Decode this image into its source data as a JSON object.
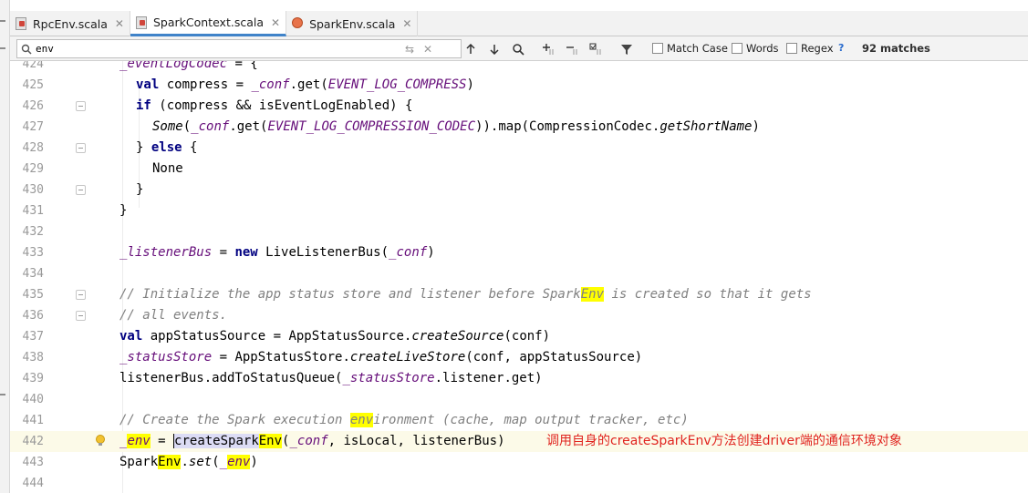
{
  "tabs": [
    {
      "label": "RpcEnv.scala",
      "icon": "scala-file-icon",
      "active": false
    },
    {
      "label": "SparkContext.scala",
      "icon": "scala-file-icon",
      "active": true
    },
    {
      "label": "SparkEnv.scala",
      "icon": "scala-object-icon",
      "active": false
    }
  ],
  "search": {
    "query": "env",
    "match_case_label": "Match Case",
    "words_label": "Words",
    "regex_label": "Regex",
    "help_label": "?",
    "matches_label": "92 matches"
  },
  "lines": {
    "n424": "424",
    "n425": "425",
    "n426": "426",
    "n427": "427",
    "n428": "428",
    "n429": "429",
    "n430": "430",
    "n431": "431",
    "n432": "432",
    "n433": "433",
    "n434": "434",
    "n435": "435",
    "n436": "436",
    "n437": "437",
    "n438": "438",
    "n439": "439",
    "n440": "440",
    "n441": "441",
    "n442": "442",
    "n443": "443",
    "n444": "444"
  },
  "code": {
    "l424_a": "_eventLogCodec",
    "l424_b": " = {",
    "l425_kw": "val",
    "l425_a": " compress = ",
    "l425_fld": "_conf",
    "l425_b": ".get(",
    "l425_const": "EVENT_LOG_COMPRESS",
    "l425_c": ")",
    "l426_kw": "if",
    "l426_a": " (compress && isEventLogEnabled) {",
    "l427_it": "Some",
    "l427_a": "(",
    "l427_fld": "_conf",
    "l427_b": ".get(",
    "l427_const": "EVENT_LOG_COMPRESSION_CODEC",
    "l427_c": ")).map(CompressionCodec.",
    "l427_it2": "getShortName",
    "l427_d": ")",
    "l428_a": "} ",
    "l428_kw": "else",
    "l428_b": " {",
    "l429_a": "None",
    "l430_a": "}",
    "l431_a": "}",
    "l433_fld": "_listenerBus",
    "l433_a": " = ",
    "l433_kw": "new",
    "l433_b": " LiveListenerBus(",
    "l433_fld2": "_conf",
    "l433_c": ")",
    "l435_a": "// Initialize the app status store and listener before Spark",
    "l435_hl": "Env",
    "l435_b": " is created so that it gets",
    "l436_a": "// all events.",
    "l437_kw": "val",
    "l437_a": " appStatusSource = AppStatusSource.",
    "l437_it": "createSource",
    "l437_b": "(conf)",
    "l438_fld": "_statusStore",
    "l438_a": " = AppStatusStore.",
    "l438_it": "createLiveStore",
    "l438_b": "(conf, appStatusSource)",
    "l439_a": "listenerBus.addToStatusQueue(",
    "l439_fld": "_statusStore",
    "l439_b": ".listener.get)",
    "l441_a": "// Create the Spark execution ",
    "l441_hl": "env",
    "l441_b": "ironment (cache, map output tracker, etc)",
    "l442_fld": "_",
    "l442_hl": "env",
    "l442_a": " = ",
    "l442_sel1": "createSpark",
    "l442_hl2": "Env",
    "l442_b": "(",
    "l442_fld2": "_conf",
    "l442_c": ", isLocal, listenerBus)",
    "l443_a": "Spark",
    "l443_hl": "Env",
    "l443_b": ".",
    "l443_it": "set",
    "l443_c": "(",
    "l443_fld": "_",
    "l443_hl2": "env",
    "l443_d": ")"
  },
  "annotation": "调用自身的createSparkEnv方法创建driver端的通信环境对象",
  "colors": {
    "keyword": "#000080",
    "field": "#660e7a",
    "comment": "#808080",
    "match_highlight": "#ffff00",
    "annotation": "#e0241f",
    "current_line": "#fcfae8"
  }
}
